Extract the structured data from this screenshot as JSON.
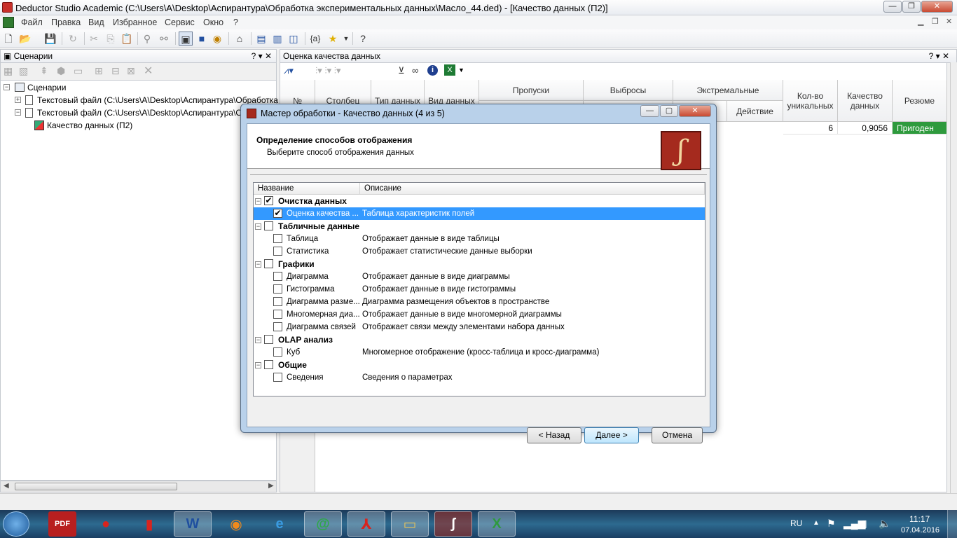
{
  "window": {
    "title": "Deductor Studio Academic (C:\\Users\\A\\Desktop\\Аспирантура\\Обработка экспериментальных данных\\Масло_44.ded) - [Качество данных (П2)]"
  },
  "menu": [
    "Файл",
    "Правка",
    "Вид",
    "Избранное",
    "Сервис",
    "Окно",
    "?"
  ],
  "scenarios_panel": {
    "title": "Сценарии",
    "controls": "? ▾ ✕",
    "tree": [
      {
        "label": "Сценарии"
      },
      {
        "label": "Текстовый файл (C:\\Users\\A\\Desktop\\Аспирантура\\Обработка экс"
      },
      {
        "label": "Текстовый файл (C:\\Users\\A\\Desktop\\Аспирантура\\Обра"
      },
      {
        "label": "Качество данных (П2)"
      }
    ]
  },
  "quality_panel": {
    "title": "Оценка качества данных",
    "controls": "? ▾ ✕",
    "headers": {
      "num": "№",
      "column": "Столбец",
      "datatype": "Тип данных",
      "kind": "Вид данных",
      "gaps": "Пропуски",
      "outliers": "Выбросы",
      "extremes": "Экстремальные",
      "action": "Действие",
      "unique": "Кол-во уникальных",
      "quality": "Качество данных",
      "summary": "Резюме"
    },
    "row": {
      "unique": "6",
      "quality": "0,9056",
      "summary": "Пригоден"
    }
  },
  "dialog": {
    "title": "Мастер обработки - Качество данных (4 из 5)",
    "heading": "Определение способов отображения",
    "subheading": "Выберите способ отображения данных",
    "col_name": "Название",
    "col_desc": "Описание",
    "groups": [
      {
        "label": "Очистка данных",
        "checked": true,
        "items": [
          {
            "name": "Оценка качества ...",
            "desc": "Таблица характеристик полей",
            "checked": true,
            "selected": true
          }
        ]
      },
      {
        "label": "Табличные данные",
        "checked": false,
        "items": [
          {
            "name": "Таблица",
            "desc": "Отображает данные в виде таблицы",
            "checked": false
          },
          {
            "name": "Статистика",
            "desc": "Отображает статистические данные выборки",
            "checked": false
          }
        ]
      },
      {
        "label": "Графики",
        "checked": false,
        "items": [
          {
            "name": "Диаграмма",
            "desc": "Отображает данные в виде диаграммы",
            "checked": false
          },
          {
            "name": "Гистограмма",
            "desc": "Отображает данные в виде гистограммы",
            "checked": false
          },
          {
            "name": "Диаграмма разме...",
            "desc": "Диаграмма размещения объектов в пространстве",
            "checked": false
          },
          {
            "name": "Многомерная диа...",
            "desc": "Отображает данные в виде многомерной диаграммы",
            "checked": false
          },
          {
            "name": "Диаграмма связей",
            "desc": "Отображает связи между элементами набора данных",
            "checked": false
          }
        ]
      },
      {
        "label": "OLAP анализ",
        "checked": false,
        "items": [
          {
            "name": "Куб",
            "desc": "Многомерное отображение (кросс-таблица и кросс-диаграмма)",
            "checked": false
          }
        ]
      },
      {
        "label": "Общие",
        "checked": false,
        "items": [
          {
            "name": "Сведения",
            "desc": "Сведения о параметрах",
            "checked": false
          }
        ]
      }
    ],
    "buttons": {
      "back": "< Назад",
      "next": "Далее >",
      "cancel": "Отмена"
    }
  },
  "taskbar": {
    "lang": "RU",
    "time": "11:17",
    "date": "07.04.2016",
    "apps": [
      "pdf-converter",
      "app-red-circle",
      "red-book",
      "word",
      "firefox",
      "internet-explorer",
      "mail-agent",
      "acrobat",
      "file-explorer",
      "deductor",
      "excel"
    ]
  },
  "colors": {
    "selection": "#3399ff",
    "good_badge": "#2e9a3d",
    "accent": "#a52a1e"
  }
}
